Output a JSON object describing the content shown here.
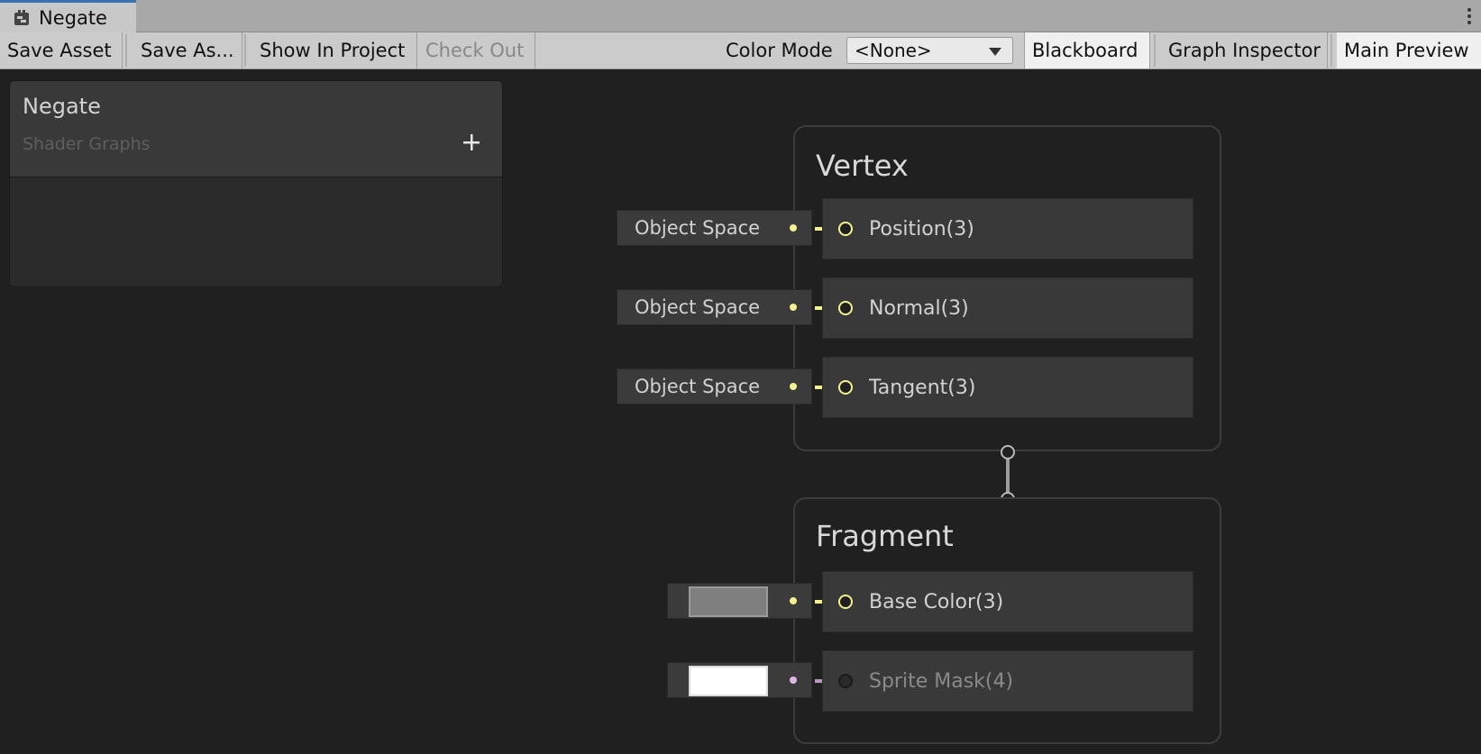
{
  "tab": {
    "title": "Negate",
    "icon": "shader-graph-icon"
  },
  "toolbar": {
    "save_asset": "Save Asset",
    "save_as": "Save As...",
    "show_in_project": "Show In Project",
    "check_out": "Check Out",
    "color_mode_label": "Color Mode",
    "color_mode_value": "<None>",
    "blackboard": "Blackboard",
    "graph_inspector": "Graph Inspector",
    "main_preview": "Main Preview"
  },
  "blackboard": {
    "title": "Negate",
    "subtitle": "Shader Graphs",
    "add_icon": "plus-icon"
  },
  "vertex": {
    "title": "Vertex",
    "blocks": [
      {
        "label": "Position(3)",
        "input": "Object Space"
      },
      {
        "label": "Normal(3)",
        "input": "Object Space"
      },
      {
        "label": "Tangent(3)",
        "input": "Object Space"
      }
    ]
  },
  "fragment": {
    "title": "Fragment",
    "blocks": [
      {
        "label": "Base Color(3)",
        "swatch": "#7f7f7f"
      },
      {
        "label": "Sprite Mask(4)",
        "swatch": "#ffffff"
      }
    ]
  },
  "colors": {
    "vector3_port": "#f4f290",
    "vector4_port": "#e2b6e6",
    "accent": "#3a72b0"
  }
}
